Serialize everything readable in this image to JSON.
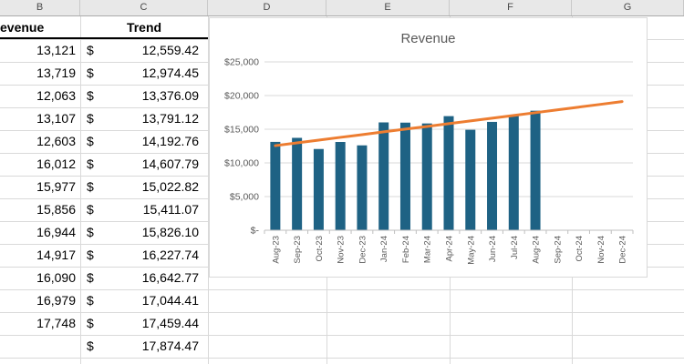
{
  "sheet": {
    "column_headers": [
      "B",
      "C",
      "D",
      "E",
      "F",
      "G"
    ],
    "table": {
      "header_b": "evenue",
      "header_c": "Trend",
      "currency": "$",
      "rows": [
        {
          "b": "13,121",
          "c": "12,559.42"
        },
        {
          "b": "13,719",
          "c": "12,974.45"
        },
        {
          "b": "12,063",
          "c": "13,376.09"
        },
        {
          "b": "13,107",
          "c": "13,791.12"
        },
        {
          "b": "12,603",
          "c": "14,192.76"
        },
        {
          "b": "16,012",
          "c": "14,607.79"
        },
        {
          "b": "15,977",
          "c": "15,022.82"
        },
        {
          "b": "15,856",
          "c": "15,411.07"
        },
        {
          "b": "16,944",
          "c": "15,826.10"
        },
        {
          "b": "14,917",
          "c": "16,227.74"
        },
        {
          "b": "16,090",
          "c": "16,642.77"
        },
        {
          "b": "16,979",
          "c": "17,044.41"
        },
        {
          "b": "17,748",
          "c": "17,459.44"
        },
        {
          "b": "",
          "c": "17,874.47"
        }
      ]
    }
  },
  "chart_data": {
    "type": "bar",
    "title": "Revenue",
    "categories": [
      "Aug-23",
      "Sep-23",
      "Oct-23",
      "Nov-23",
      "Dec-23",
      "Jan-24",
      "Feb-24",
      "Mar-24",
      "Apr-24",
      "May-24",
      "Jun-24",
      "Jul-24",
      "Aug-24",
      "Sep-24",
      "Oct-24",
      "Nov-24",
      "Dec-24"
    ],
    "series": [
      {
        "name": "Revenue",
        "type": "bar",
        "color": "#1E6284",
        "values": [
          13121,
          13719,
          12063,
          13107,
          12603,
          16012,
          15977,
          15856,
          16944,
          14917,
          16090,
          16979,
          17748,
          null,
          null,
          null,
          null
        ]
      },
      {
        "name": "Trend",
        "type": "line",
        "color": "#ED7D31",
        "values": [
          12559.42,
          12974.45,
          13376.09,
          13791.12,
          14192.76,
          14607.79,
          15022.82,
          15411.07,
          15826.1,
          16227.74,
          16642.77,
          17044.41,
          17459.44,
          17874.47,
          18283.32,
          18692.17,
          19101.02
        ]
      }
    ],
    "ylim": [
      0,
      25000
    ],
    "y_ticks": [
      0,
      5000,
      10000,
      15000,
      20000,
      25000
    ],
    "y_tick_labels": [
      "$-",
      "$5,000",
      "$10,000",
      "$15,000",
      "$20,000",
      "$25,000"
    ],
    "xlabel": "",
    "ylabel": "",
    "grid": true,
    "legend": "none",
    "x_labels_rotated_deg": 90,
    "colors": {
      "title_text": "#595959",
      "axis_label_text": "#595959",
      "plot_gridline": "#d9d9d9",
      "axis_line": "#bfbfbf"
    }
  }
}
